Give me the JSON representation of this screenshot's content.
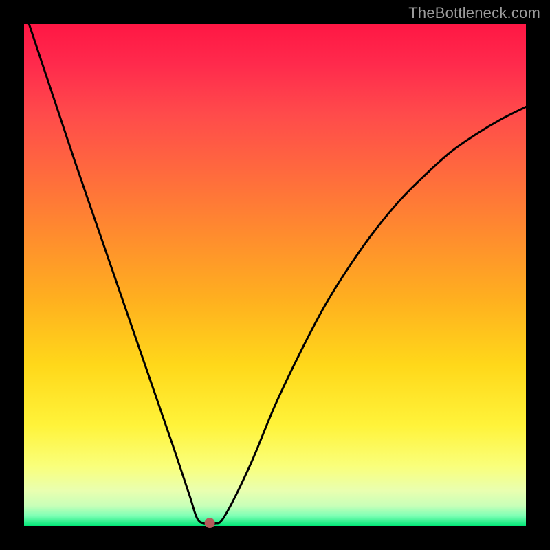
{
  "watermark": "TheBottleneck.com",
  "chart_data": {
    "type": "line",
    "title": "",
    "xlabel": "",
    "ylabel": "",
    "xlim": [
      0,
      100
    ],
    "ylim": [
      0,
      100
    ],
    "grid": false,
    "legend": false,
    "series": [
      {
        "name": "bottleneck-curve",
        "color": "#000000",
        "x": [
          1,
          5,
          10,
          15,
          20,
          25,
          30,
          33,
          34.5,
          36,
          38,
          40,
          45,
          50,
          55,
          60,
          65,
          70,
          75,
          80,
          85,
          90,
          95,
          100
        ],
        "y": [
          100,
          88,
          73,
          58.5,
          44,
          29.5,
          15,
          6,
          1.5,
          0.5,
          0.5,
          2,
          12,
          24,
          34.5,
          44,
          52,
          59,
          65,
          70,
          74.5,
          78,
          81,
          83.5
        ]
      }
    ],
    "marker": {
      "name": "optimal-point",
      "x": 37,
      "y": 0.6,
      "color": "#b55a5a",
      "radius_px": 7
    }
  },
  "colors": {
    "gradient_top": "#ff1744",
    "gradient_bottom": "#00e676",
    "frame": "#000000",
    "curve": "#000000",
    "watermark": "#9c9c9c"
  }
}
